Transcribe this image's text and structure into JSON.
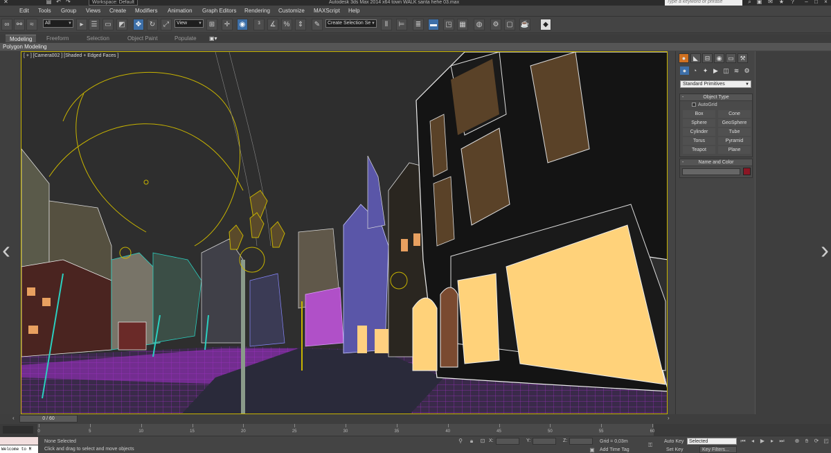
{
  "titlebar": {
    "workspace": "Workspace: Default",
    "title": "Autodesk 3ds Max  2014 x64      town WALK santa hehe 03.max",
    "search_placeholder": "Type a keyword or phrase"
  },
  "menu": [
    "Edit",
    "Tools",
    "Group",
    "Views",
    "Create",
    "Modifiers",
    "Animation",
    "Graph Editors",
    "Rendering",
    "Customize",
    "MAXScript",
    "Help"
  ],
  "toolbar": {
    "filter_value": "All",
    "refcoord_value": "View",
    "selection_set_placeholder": "Create Selection Se"
  },
  "ribbon": {
    "tabs": [
      "Modeling",
      "Freeform",
      "Selection",
      "Object Paint",
      "Populate"
    ],
    "active_tab": "Modeling",
    "sub_label": "Polygon Modeling"
  },
  "viewport": {
    "label": "[ + ] [Camera002 ] [Shaded + Edged Faces ]",
    "border_color": "#c8b400"
  },
  "command_panel": {
    "category": "Standard Primitives",
    "object_type_title": "Object Type",
    "autogrid_label": "AutoGrid",
    "object_buttons": [
      "Box",
      "Cone",
      "Sphere",
      "GeoSphere",
      "Cylinder",
      "Tube",
      "Torus",
      "Pyramid",
      "Teapot",
      "Plane"
    ],
    "name_color_title": "Name and Color",
    "swatch_color": "#8b1624"
  },
  "timeline": {
    "frame_display": "0 / 60",
    "ticks": [
      "0",
      "5",
      "10",
      "15",
      "20",
      "25",
      "30",
      "35",
      "40",
      "45",
      "50",
      "55",
      "60"
    ]
  },
  "status": {
    "listener_text": "Welcome to M",
    "selection_text": "None Selected",
    "prompt_text": "Click and drag to select and move objects",
    "x_label": "X:",
    "y_label": "Y:",
    "z_label": "Z:",
    "grid_text": "Grid = 0,03m",
    "add_time_tag": "Add Time Tag",
    "auto_key": "Auto Key",
    "set_key": "Set Key",
    "selected_value": "Selected",
    "key_filters": "Key Filters..."
  }
}
